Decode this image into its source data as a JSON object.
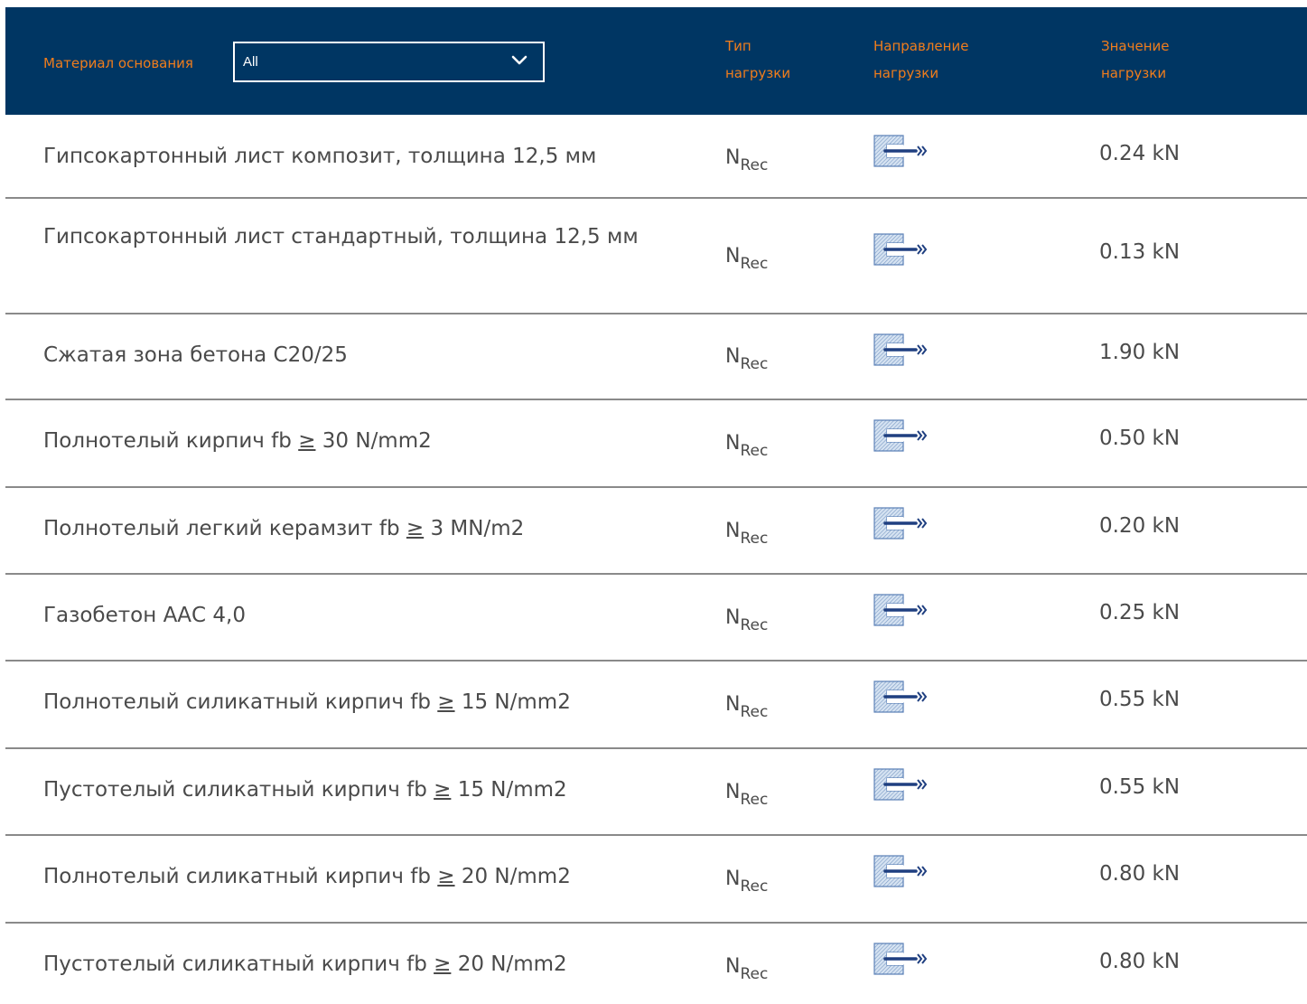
{
  "header": {
    "base_material_label": "Материал основания",
    "filter_value": "All",
    "col_type": [
      "Тип",
      "нагрузки"
    ],
    "col_direction": [
      "Направление",
      "нагрузки"
    ],
    "col_value": [
      "Значение",
      "нагрузки"
    ]
  },
  "rows": [
    {
      "material": "Гипсокартонный лист композит, толщина 12,5 мм",
      "type_main": "N",
      "type_sub": "Rec",
      "value": "0.24 kN"
    },
    {
      "material": "Гипсокартонный лист стандартный, толщина 12,5 мм",
      "type_main": "N",
      "type_sub": "Rec",
      "value": "0.13 kN"
    },
    {
      "material": "Сжатая зона бетона С20/25",
      "type_main": "N",
      "type_sub": "Rec",
      "value": "1.90 kN"
    },
    {
      "material_pre": "Полнотелый кирпич fb ",
      "material_sym": "≥",
      "material_post": " 30 N/mm2",
      "type_main": "N",
      "type_sub": "Rec",
      "value": "0.50 kN"
    },
    {
      "material_pre": "Полнотелый легкий керамзит fb ",
      "material_sym": "≥",
      "material_post": " 3 MN/m2",
      "type_main": "N",
      "type_sub": "Rec",
      "value": "0.20 kN"
    },
    {
      "material": "Газобетон ААС 4,0",
      "type_main": "N",
      "type_sub": "Rec",
      "value": "0.25 kN"
    },
    {
      "material_pre": "Полнотелый силикатный кирпич fb ",
      "material_sym": "≥",
      "material_post": " 15 N/mm2",
      "type_main": "N",
      "type_sub": "Rec",
      "value": "0.55 kN"
    },
    {
      "material_pre": "Пустотелый силикатный кирпич fb ",
      "material_sym": "≥",
      "material_post": " 15 N/mm2",
      "type_main": "N",
      "type_sub": "Rec",
      "value": "0.55 kN"
    },
    {
      "material_pre": "Полнотелый силикатный кирпич fb ",
      "material_sym": "≥",
      "material_post": " 20 N/mm2",
      "type_main": "N",
      "type_sub": "Rec",
      "value": "0.80 kN"
    },
    {
      "material_pre": "Пустотелый силикатный кирпич fb ",
      "material_sym": "≥",
      "material_post": " 20 N/mm2",
      "type_main": "N",
      "type_sub": "Rec",
      "value": "0.80 kN"
    }
  ],
  "colors": {
    "header_bg": "#003663",
    "accent": "#f07d1c",
    "text": "#4a4a4a",
    "divider": "#8a8a8a"
  },
  "icons": {
    "direction": "tension-load-direction-icon",
    "dropdown": "chevron-down-icon"
  }
}
